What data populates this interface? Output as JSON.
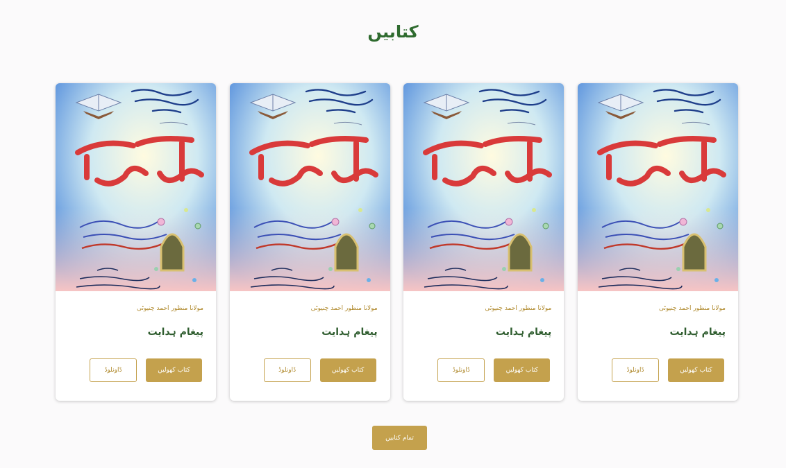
{
  "page": {
    "title": "کتابیں"
  },
  "books": [
    {
      "author": "مولانا منظور احمد چنیوٹی",
      "title": "پیغام ہدایت",
      "cover_title": "پیغامِ ھدایت",
      "view_label": "کتاب کھولیں",
      "download_label": "ڈاونلوڈ"
    },
    {
      "author": "مولانا منظور احمد چنیوٹی",
      "title": "پیغام ہدایت",
      "cover_title": "پیغامِ ھدایت",
      "view_label": "کتاب کھولیں",
      "download_label": "ڈاونلوڈ"
    },
    {
      "author": "مولانا منظور احمد چنیوٹی",
      "title": "پیغام ہدایت",
      "cover_title": "پیغامِ ھدایت",
      "view_label": "کتاب کھولیں",
      "download_label": "ڈاونلوڈ"
    },
    {
      "author": "مولانا منظور احمد چنیوٹی",
      "title": "پیغام ہدایت",
      "cover_title": "پیغامِ ھدایت",
      "view_label": "کتاب کھولیں",
      "download_label": "ڈاونلوڈ"
    }
  ],
  "footer": {
    "all_books_label": "تمام کتابیں"
  },
  "colors": {
    "accent": "#c4a14d",
    "title_green": "#2f6b2f"
  }
}
